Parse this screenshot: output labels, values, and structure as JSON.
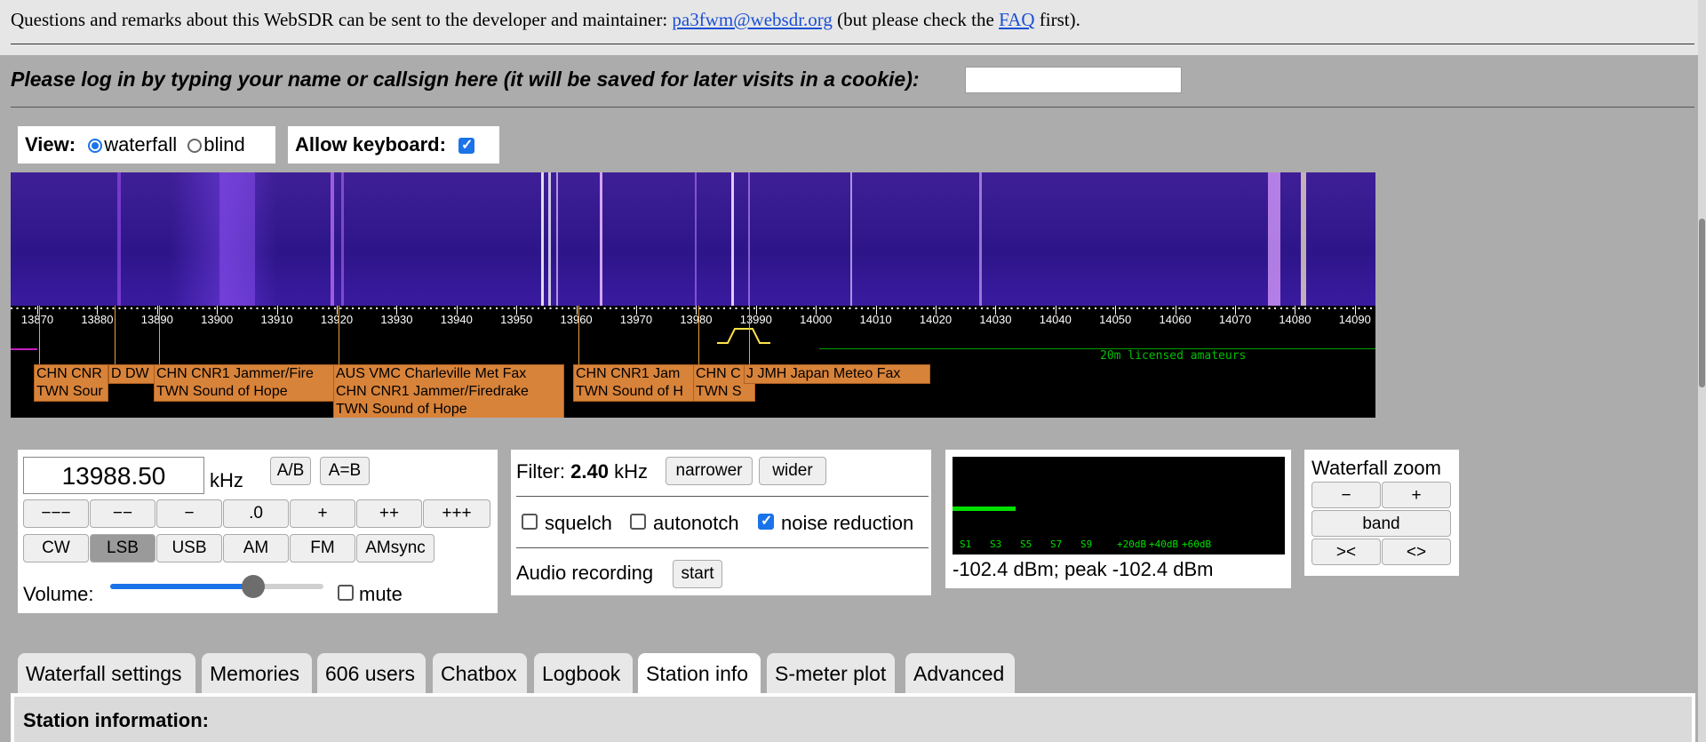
{
  "header": {
    "text_prefix": "Questions and remarks about this WebSDR can be sent to the developer and maintainer: ",
    "email": "pa3fwm@websdr.org",
    "text_mid": " (but please check the ",
    "faq": "FAQ",
    "text_suffix": " first)."
  },
  "login": {
    "prompt": "Please log in by typing your name or callsign here (it will be saved for later visits in a cookie):",
    "value": ""
  },
  "view": {
    "label": "View:",
    "options": [
      "waterfall",
      "blind"
    ],
    "selected": "waterfall"
  },
  "keyboard": {
    "label": "Allow keyboard:",
    "checked": true
  },
  "scale": {
    "ticks": [
      "13870",
      "13880",
      "13890",
      "13900",
      "13910",
      "13920",
      "13930",
      "13940",
      "13950",
      "13960",
      "13970",
      "13980",
      "13990",
      "14000",
      "14010",
      "14020",
      "14030",
      "14040",
      "14050",
      "14060",
      "14070",
      "14080",
      "14090"
    ],
    "band_label": "20m licensed amateurs"
  },
  "stations": [
    {
      "line1": "CHN CNR",
      "line2": "TWN Sour"
    },
    {
      "line1": "D DW",
      "line2": ""
    },
    {
      "line1": "CHN CNR1 Jammer/Fire",
      "line2": "TWN Sound of Hope"
    },
    {
      "line1": "AUS VMC Charleville Met Fax",
      "line2": "CHN CNR1 Jammer/Firedrake",
      "line3": "TWN Sound of Hope"
    },
    {
      "line1": "CHN CNR1 Jam",
      "line2": "TWN Sound of H"
    },
    {
      "line1": "CHN C",
      "line2": "TWN S"
    },
    {
      "line1": "J JMH Japan Meteo Fax",
      "line2": ""
    }
  ],
  "tuning": {
    "frequency": "13988.50",
    "unit": "kHz",
    "ab": "A/B",
    "aeqb": "A=B",
    "step_buttons": [
      "−−−",
      "−−",
      "−",
      ".0",
      "+",
      "++",
      "+++"
    ],
    "modes": [
      "CW",
      "LSB",
      "USB",
      "AM",
      "FM",
      "AMsync"
    ],
    "selected_mode": "LSB",
    "volume_label": "Volume:",
    "volume_level": 0.67,
    "mute_label": "mute"
  },
  "filter": {
    "label": "Filter:",
    "width": "2.40",
    "unit": "kHz",
    "narrower": "narrower",
    "wider": "wider",
    "squelch": "squelch",
    "autonotch": "autonotch",
    "noise_reduction": "noise reduction",
    "noise_reduction_checked": true,
    "audio_recording": "Audio recording",
    "start": "start"
  },
  "smeter": {
    "scale_labels": [
      "S1",
      "S3",
      "S5",
      "S7",
      "S9",
      "+20dB",
      "+40dB",
      "+60dB"
    ],
    "readout": "-102.4 dBm; peak -102.4 dBm",
    "level": 0.19
  },
  "zoom": {
    "title": "Waterfall zoom",
    "minus": "−",
    "plus": "+",
    "band": "band",
    "out": "><",
    "in": "<>"
  },
  "tabs": [
    "Waterfall settings",
    "Memories",
    "606 users",
    "Chatbox",
    "Logbook",
    "Station info",
    "S-meter plot",
    "Advanced"
  ],
  "active_tab": "Station info",
  "station_info": {
    "title": "Station information:"
  },
  "colors": {
    "accent": "#1a73e8",
    "label_bg": "#d8833a",
    "waterfall": "#2d1589",
    "band": "#00c000"
  }
}
